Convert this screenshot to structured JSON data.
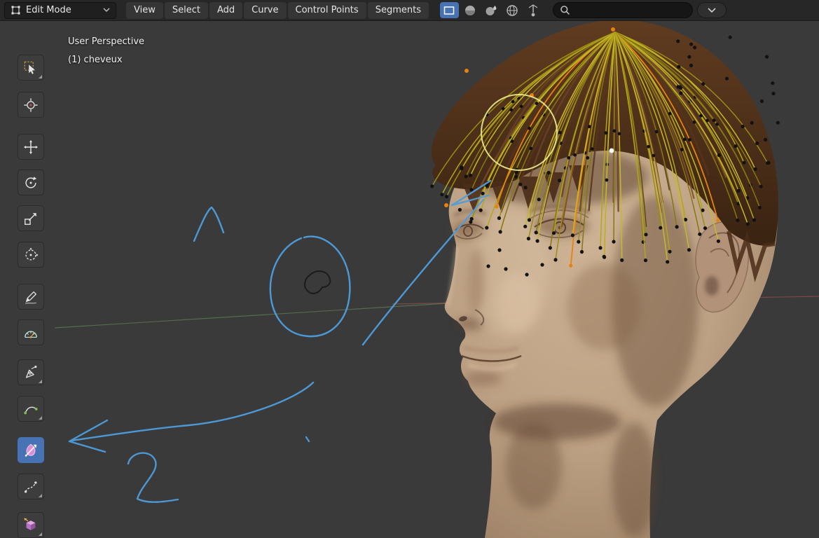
{
  "header": {
    "mode": {
      "label": "Edit Mode"
    },
    "menus": [
      "View",
      "Select",
      "Add",
      "Curve",
      "Control Points",
      "Segments"
    ],
    "mode_buttons": [
      "select-box",
      "proportional-sphere",
      "falloff-sphere",
      "snap-globe",
      "gizmo-axis"
    ],
    "search": {
      "placeholder": "",
      "value": ""
    }
  },
  "viewport": {
    "perspective_label": "User Perspective",
    "object_label": "(1) cheveux",
    "annotation_color": "#4e9edd",
    "brush_circle_color": "#eded8e",
    "selection_color": "#e8820e",
    "background": "#3a3a3a"
  },
  "toolbar": {
    "active_tool": "radius-comb",
    "tools": [
      "tweak-select",
      "cursor-3d",
      "move",
      "rotate",
      "scale",
      "transform",
      "annotate",
      "measure",
      "curve-pen",
      "curve-draw",
      "radius-comb",
      "randomize",
      "extrude"
    ]
  },
  "colors": {
    "accent": "#4772b3"
  }
}
